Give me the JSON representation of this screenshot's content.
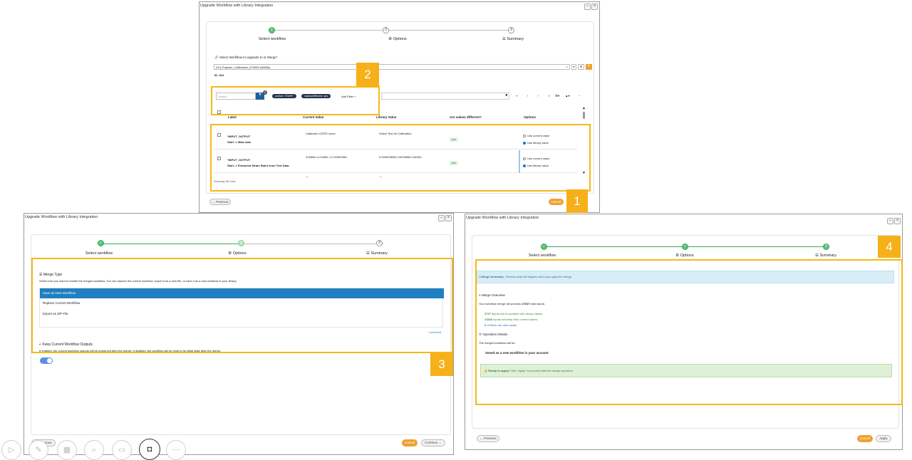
{
  "window_title": "Upgrade Workflow with Library Integration",
  "controls": {
    "minimize": "–",
    "close": "×"
  },
  "steps": [
    "Select workflow",
    "Options",
    "Summary"
  ],
  "step_numbers": [
    "1",
    "2",
    "3"
  ],
  "step_icons": {
    "options": "gear-icon",
    "summary": "list-icon"
  },
  "shot1": {
    "select_label": "Select Workflow to Upgrade to or Merge",
    "required_mark": "*",
    "workflow_value": "013_Polymer_Calibration_073025.a3WfZip",
    "id_label": "ID: 813",
    "search_placeholder": "Search",
    "filter_badge": "2",
    "chips": [
      "worker: START",
      "valuesDifferent: yes"
    ],
    "add_filter": "Add Filter +",
    "pager": [
      "«",
      "‹",
      "›",
      "»"
    ],
    "columns": [
      "Label",
      "Current Value",
      "Library Value",
      "Are values different?",
      "Options"
    ],
    "rows": [
      {
        "label": "INPUT_OUTPUT",
        "path": "Start -> Main task",
        "current": "Calibrate LCDRS curve",
        "library": "Select Test for Calibration",
        "different": "yes",
        "opt1": "Use current value",
        "opt2": "Use library value"
      },
      {
        "label": "INPUT_OUTPUT",
        "path": "Start -> Extracted Strain Rates from Test Data",
        "current": "3.8360e-4,3.839e-7,0.00000383...",
        "library": "0.000003838,0.0003838,0.00383...",
        "different": "yes",
        "opt1": "Use current value",
        "opt2": "Use library value"
      }
    ],
    "row3_current": "—",
    "row3_library": "—",
    "showing": "Showing 36 rows.",
    "previous": "← Previous",
    "cancel": "Cancel"
  },
  "shot3": {
    "merge_type_title": "Merge Type",
    "merge_type_desc": "Select how you want to handle the merged workflow. You can replace the current workflow, export it as a new file, or save it as a new workflow in your library.",
    "options": [
      "Save as New Workflow",
      "Replace Current Workflow",
      "Export as ZIP File"
    ],
    "selected_count": "1 selected",
    "keep_title": "Keep Current Workflow Outputs",
    "keep_desc": "If enabled, the current workflow outputs will be preserved after the merge. If disabled, the workflow will be reset to its initial state after the merge.",
    "previous": "← Previous",
    "cancel": "Cancel",
    "continue": "Continue →"
  },
  "shot4": {
    "summary_title": "Merge Summary",
    "summary_desc": " - Review what will happen when you apply the merge.",
    "overview_title": "Merge Overview",
    "process_pre": "Your workflow merge will process ",
    "process_count": "17047",
    "process_post": " total inputs:",
    "updated_count": "3727",
    "updated_text": " inputs will be updated with library values",
    "keep_count": "13320",
    "keep_text": " inputs will keep their current values",
    "user_count": "0",
    "user_text": " of these are user inputs",
    "details_title": "Operation Details",
    "details_desc": "The merged workflow will be:",
    "details_value": "Saved as a new workflow in your account",
    "ready_title": "Ready to apply!",
    "ready_desc": " Click \"Apply\" to proceed with the merge operation.",
    "previous": "← Previous",
    "cancel": "Cancel",
    "apply": "Apply"
  },
  "callouts": [
    "1",
    "2",
    "3",
    "4"
  ],
  "taskbar": [
    "play-icon",
    "pen-icon",
    "slides-icon",
    "search-icon",
    "subtitle-icon",
    "camera-icon",
    "more-icon"
  ],
  "colors": {
    "highlight": "#f5b916",
    "callout": "#f5b01a",
    "primary": "#1f7fc2",
    "success": "#5cc27a",
    "cancel": "#f0a030"
  }
}
